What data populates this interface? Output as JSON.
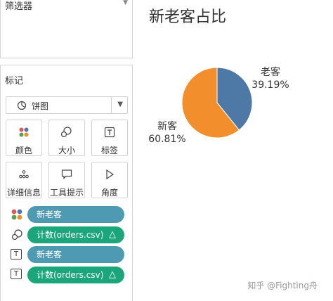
{
  "filters": {
    "title": "筛选器"
  },
  "marks": {
    "title": "标记",
    "mark_type": "饼图",
    "buttons": [
      {
        "label": "颜色",
        "icon": "color-dots-icon"
      },
      {
        "label": "大小",
        "icon": "size-icon"
      },
      {
        "label": "标签",
        "icon": "label-icon"
      },
      {
        "label": "详细信息",
        "icon": "detail-icon"
      },
      {
        "label": "工具提示",
        "icon": "tooltip-icon"
      },
      {
        "label": "角度",
        "icon": "angle-icon"
      }
    ],
    "fields": [
      {
        "name": "新老客",
        "role": "color",
        "pill_color": "#4e9ab3"
      },
      {
        "name": "计数(orders.csv)",
        "role": "angle",
        "delta": "△",
        "pill_color": "#1aa67a"
      },
      {
        "name": "新老客",
        "role": "label",
        "pill_color": "#4e9ab3"
      },
      {
        "name": "计数(orders.csv)",
        "role": "label",
        "delta": "△",
        "pill_color": "#1aa67a"
      }
    ]
  },
  "view": {
    "title": "新老客占比",
    "watermark": "知乎 @Fighting舟"
  },
  "chart_data": {
    "type": "pie",
    "title": "新老客占比",
    "slices": [
      {
        "name": "老客",
        "percent_label": "39.19%",
        "value": 39.19,
        "color": "#4e79a7"
      },
      {
        "name": "新客",
        "percent_label": "60.81%",
        "value": 60.81,
        "color": "#f28e2b"
      }
    ]
  }
}
